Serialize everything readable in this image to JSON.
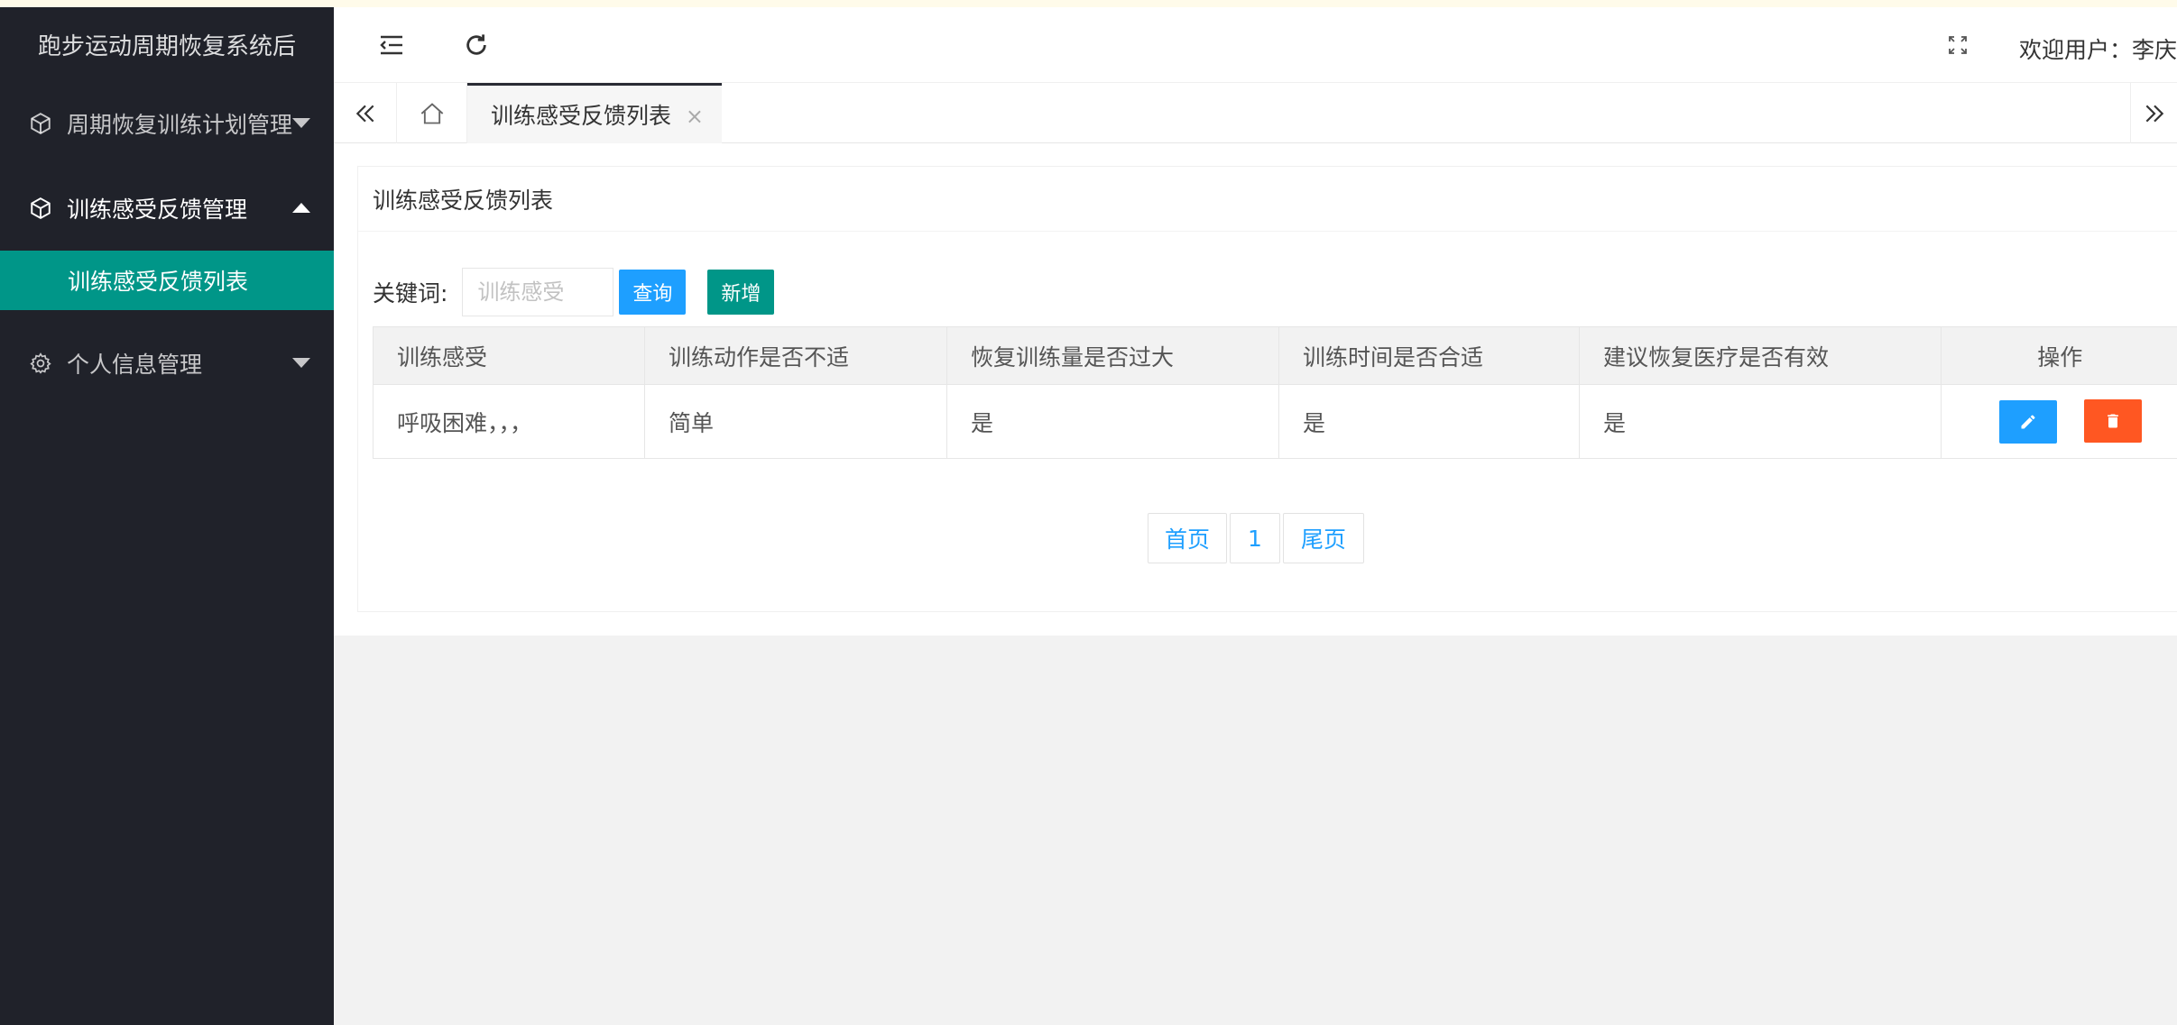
{
  "sidebar": {
    "logo": "跑步运动周期恢复系统后",
    "items": [
      {
        "label": "周期恢复训练计划管理",
        "icon": "cube-icon",
        "expanded": false
      },
      {
        "label": "训练感受反馈管理",
        "icon": "cube-icon",
        "expanded": true,
        "children": [
          {
            "label": "训练感受反馈列表",
            "active": true
          }
        ]
      },
      {
        "label": "个人信息管理",
        "icon": "gear-icon",
        "expanded": false
      }
    ]
  },
  "header": {
    "menu_toggle_icon": "menu-fold-icon",
    "refresh_icon": "refresh-icon",
    "fullscreen_icon": "fullscreen-icon",
    "welcome_text": "欢迎用户：李庆"
  },
  "tabs": {
    "home_icon": "home-icon",
    "active_tab": "训练感受反馈列表",
    "close_glyph": "×"
  },
  "card": {
    "title": "训练感受反馈列表",
    "search": {
      "label": "关键词:",
      "placeholder": "训练感受",
      "value": "",
      "query_button": "查询",
      "add_button": "新增"
    },
    "table": {
      "columns": [
        "训练感受",
        "训练动作是否不适",
        "恢复训练量是否过大",
        "训练时间是否合适",
        "建议恢复医疗是否有效",
        "操作"
      ],
      "rows": [
        [
          "呼吸困难，，，",
          "简单",
          "是",
          "是",
          "是"
        ]
      ]
    },
    "pager": {
      "first": "首页",
      "page": "1",
      "last": "尾页"
    }
  },
  "colors": {
    "sidebar_bg": "#20222a",
    "active_green": "#009688",
    "primary_blue": "#1e9fff",
    "danger_orange": "#ff5722"
  }
}
